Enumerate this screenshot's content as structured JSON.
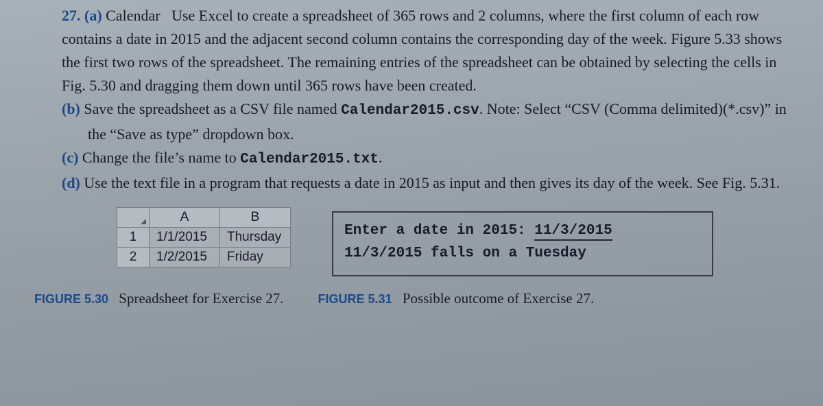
{
  "problem_number": "27.",
  "parts": {
    "a": {
      "label": "(a)",
      "title": "Calendar",
      "text": "Use Excel to create a spreadsheet of 365 rows and 2 columns, where the first column of each row contains a date in 2015 and the adjacent second column contains the corresponding day of the week. Figure 5.33 shows the first two rows of the spreadsheet. The remaining entries of the spreadsheet can be obtained by selecting the cells in Fig. 5.30 and dragging them down until 365 rows have been created."
    },
    "b": {
      "label": "(b)",
      "text_pre": "Save the spreadsheet as a CSV file named ",
      "code": "Calendar2015.csv",
      "text_post": ". Note: Select “CSV (Comma delimited)(*.csv)” in the “Save as type” dropdown box."
    },
    "c": {
      "label": "(c)",
      "text_pre": "Change the file’s name to ",
      "code": "Calendar2015.txt",
      "text_post": "."
    },
    "d": {
      "label": "(d)",
      "text": "Use the text file in a program that requests a date in 2015 as input and then gives its day of the week. See Fig. 5.31."
    }
  },
  "spreadsheet": {
    "col_a": "A",
    "col_b": "B",
    "rows": [
      {
        "n": "1",
        "a": "1/1/2015",
        "b": "Thursday"
      },
      {
        "n": "2",
        "a": "1/2/2015",
        "b": "Friday"
      }
    ]
  },
  "output": {
    "prompt": "Enter a date in 2015: ",
    "input": "11/3/2015",
    "result": "11/3/2015 falls on a Tuesday"
  },
  "captions": {
    "fig530_label": "FIGURE 5.30",
    "fig530_text": "Spreadsheet for Exercise 27.",
    "fig531_label": "FIGURE 5.31",
    "fig531_text": "Possible outcome of Exercise 27."
  }
}
